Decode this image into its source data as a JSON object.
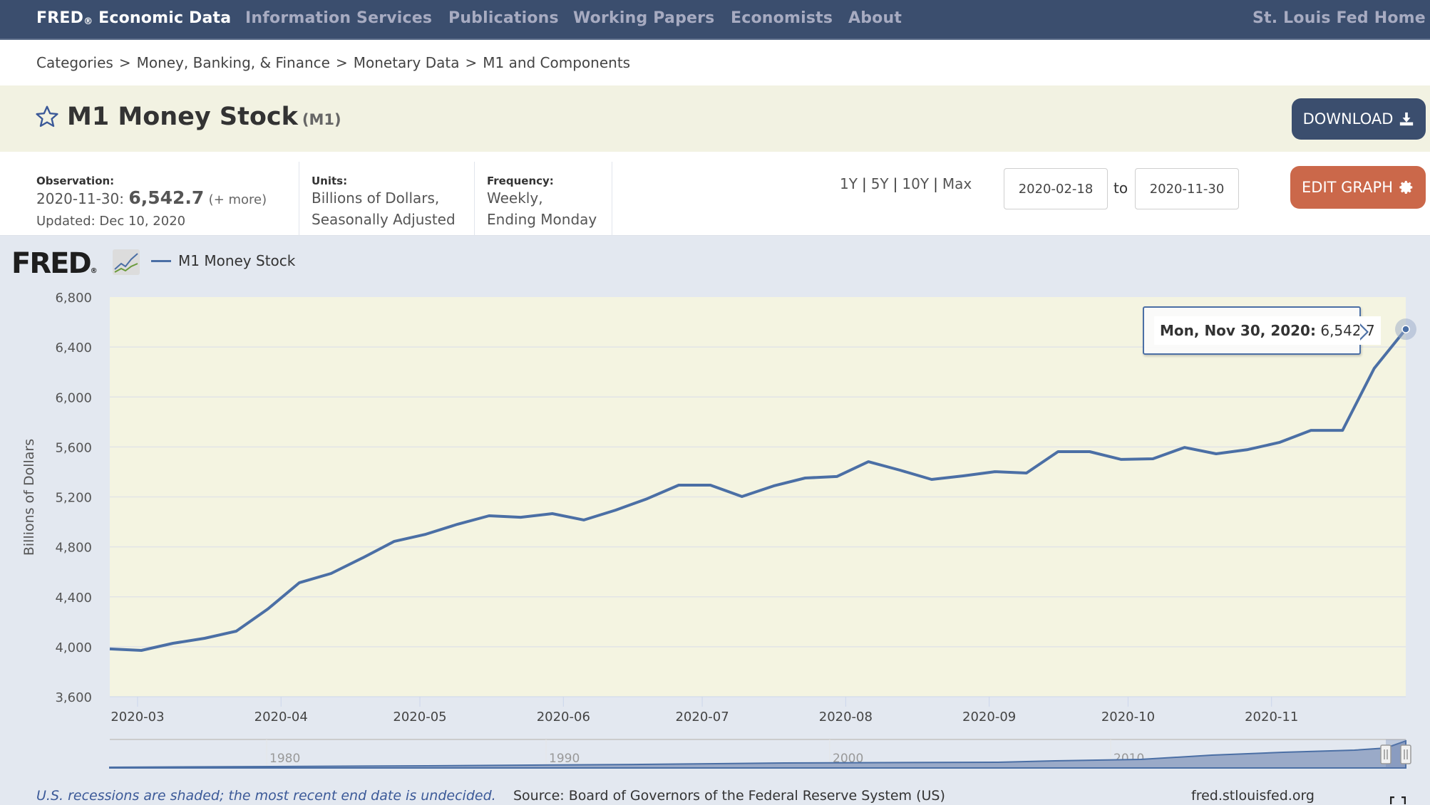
{
  "nav": {
    "brand": "FRED",
    "brand_reg": "®",
    "brand_suffix": " Economic Data",
    "items": [
      "Information Services",
      "Publications",
      "Working Papers",
      "Economists",
      "About"
    ],
    "home": "St. Louis Fed Home"
  },
  "breadcrumb": [
    "Categories",
    "Money, Banking, & Finance",
    "Monetary Data",
    "M1 and Components"
  ],
  "breadcrumb_sep": ">",
  "title": {
    "name": "M1 Money Stock",
    "series_id": "(M1)"
  },
  "buttons": {
    "download": "DOWNLOAD",
    "edit_graph": "EDIT GRAPH"
  },
  "meta": {
    "observation_label": "Observation:",
    "observation_date": "2020-11-30:",
    "observation_value": "6,542.7",
    "observation_more": "(+ more)",
    "updated": "Updated: Dec 10, 2020",
    "units_label": "Units:",
    "units_line1": "Billions of Dollars,",
    "units_line2": "Seasonally Adjusted",
    "frequency_label": "Frequency:",
    "frequency_line1": "Weekly,",
    "frequency_line2": "Ending Monday"
  },
  "range": {
    "links": [
      "1Y",
      "5Y",
      "10Y",
      "Max"
    ],
    "from": "2020-02-18",
    "to_label": "to",
    "to": "2020-11-30"
  },
  "legend": {
    "series": "M1 Money Stock",
    "color": "#4b6fa5"
  },
  "tooltip": {
    "date": "Mon, Nov 30, 2020:",
    "value": "6,542.7"
  },
  "footer": {
    "recession_note": "U.S. recessions are shaded; the most recent end date is undecided.",
    "source": "Source: Board of Governors of the Federal Reserve System (US)",
    "site": "fred.stlouisfed.org"
  },
  "colors": {
    "nav_bg": "#3b4e6e",
    "download_btn": "#3b4e6e",
    "edit_btn": "#cb684a",
    "plot_bg": "#f4f4e1",
    "line": "#4b6fa5"
  },
  "chart_data": {
    "type": "line",
    "title": "M1 Money Stock",
    "xlabel": "",
    "ylabel": "Billions of Dollars",
    "ylim": [
      3600,
      6800
    ],
    "yticks": [
      3600,
      4000,
      4400,
      4800,
      5200,
      5600,
      6000,
      6400,
      6800
    ],
    "ytick_labels": [
      "3,600",
      "4,000",
      "4,400",
      "4,800",
      "5,200",
      "5,600",
      "6,000",
      "6,400",
      "6,800"
    ],
    "xlim": [
      "2020-02-24",
      "2020-11-30"
    ],
    "xtick_labels": [
      "2020-03",
      "2020-04",
      "2020-05",
      "2020-06",
      "2020-07",
      "2020-08",
      "2020-09",
      "2020-10",
      "2020-11"
    ],
    "xtick_dates": [
      "2020-03-01",
      "2020-04-01",
      "2020-05-01",
      "2020-06-01",
      "2020-07-01",
      "2020-08-01",
      "2020-09-01",
      "2020-10-01",
      "2020-11-01"
    ],
    "grid": true,
    "legend": "top-left",
    "series": [
      {
        "name": "M1 Money Stock",
        "x": [
          "2020-02-24",
          "2020-03-02",
          "2020-03-09",
          "2020-03-16",
          "2020-03-23",
          "2020-03-30",
          "2020-04-06",
          "2020-04-13",
          "2020-04-20",
          "2020-04-27",
          "2020-05-04",
          "2020-05-11",
          "2020-05-18",
          "2020-05-25",
          "2020-06-01",
          "2020-06-08",
          "2020-06-15",
          "2020-06-22",
          "2020-06-29",
          "2020-07-06",
          "2020-07-13",
          "2020-07-20",
          "2020-07-27",
          "2020-08-03",
          "2020-08-10",
          "2020-08-17",
          "2020-08-24",
          "2020-08-31",
          "2020-09-07",
          "2020-09-14",
          "2020-09-21",
          "2020-09-28",
          "2020-10-05",
          "2020-10-12",
          "2020-10-19",
          "2020-10-26",
          "2020-11-02",
          "2020-11-09",
          "2020-11-16",
          "2020-11-23",
          "2020-11-30"
        ],
        "values": [
          3983,
          3971,
          4028,
          4068,
          4125,
          4302,
          4513,
          4587,
          4712,
          4844,
          4901,
          4981,
          5049,
          5037,
          5066,
          5015,
          5094,
          5185,
          5294,
          5294,
          5203,
          5288,
          5351,
          5363,
          5482,
          5414,
          5340,
          5368,
          5402,
          5391,
          5562,
          5562,
          5500,
          5505,
          5596,
          5545,
          5579,
          5636,
          5733,
          5733,
          6229,
          6542.7
        ]
      }
    ],
    "highlight": {
      "x": "2020-11-30",
      "value": 6542.7
    },
    "navigator": {
      "labels": [
        "1980",
        "1990",
        "2000",
        "2010"
      ],
      "range_selected": [
        "2020-02-18",
        "2020-11-30"
      ]
    }
  }
}
